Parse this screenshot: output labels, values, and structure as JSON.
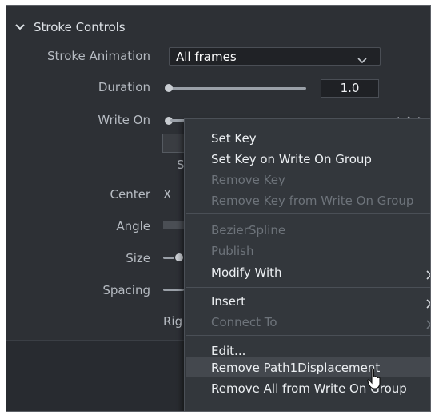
{
  "section": {
    "title": "Stroke Controls"
  },
  "controls": {
    "stroke_animation": {
      "label": "Stroke Animation",
      "value": "All frames"
    },
    "duration": {
      "label": "Duration",
      "value": "1.0"
    },
    "write_on": {
      "label": "Write On",
      "keyframe_arrows": "< ◆ >"
    },
    "partial_s": "S",
    "center": {
      "label": "Center",
      "axis": "X"
    },
    "angle": {
      "label": "Angle"
    },
    "size": {
      "label": "Size"
    },
    "spacing": {
      "label": "Spacing"
    },
    "partial_rig": "Rig"
  },
  "context_menu": {
    "items": [
      {
        "label": "Set Key",
        "enabled": true
      },
      {
        "label": "Set Key on Write On Group",
        "enabled": true
      },
      {
        "label": "Remove Key",
        "enabled": false
      },
      {
        "label": "Remove Key from Write On Group",
        "enabled": false
      },
      {
        "label": "BezierSpline",
        "enabled": false
      },
      {
        "label": "Publish",
        "enabled": false
      },
      {
        "label": "Modify With",
        "enabled": true,
        "submenu": true
      },
      {
        "label": "Insert",
        "enabled": true,
        "submenu": true
      },
      {
        "label": "Connect To",
        "enabled": false,
        "submenu": true
      },
      {
        "label": "Edit...",
        "enabled": true
      },
      {
        "label": "Remove Path1Displacement",
        "enabled": true,
        "highlighted": true
      },
      {
        "label": "Remove All from Write On Group",
        "enabled": true
      }
    ]
  },
  "colors": {
    "panel": "#2d3035",
    "menu": "#33373c",
    "text": "#eceff2",
    "disabled_text": "#6d737a"
  }
}
